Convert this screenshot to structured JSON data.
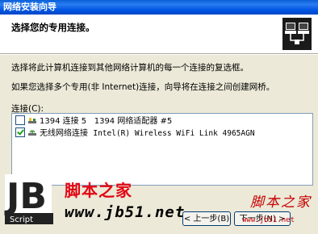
{
  "window": {
    "title": "网络安装向导"
  },
  "header": {
    "title": "选择您的专用连接。"
  },
  "body": {
    "instruction1": "选择将此计算机连接到其他网络计算机的每一个连接的复选框。",
    "instruction2": "如果您选择多个专用(非 Internet)连接，向导将在连接之间创建网桥。",
    "connections_label": "连接(C):"
  },
  "connections": [
    {
      "name": "1394 连接 5",
      "device": "1394 网络适配器 #5",
      "checked": false
    },
    {
      "name": "无线网络连接",
      "device": "Intel(R) Wireless WiFi Link 4965AGN",
      "checked": true
    }
  ],
  "buttons": {
    "back": "< 上一步(B)",
    "next": "下一步(N) >"
  },
  "watermarks": {
    "logo_letters": "JB",
    "logo_script": "Script",
    "brand": "脚本之家",
    "url": "www.jb51.net",
    "brand2": "脚本之家",
    "url2": "www.jb51.net"
  },
  "colors": {
    "titlebar": "#0054e3",
    "dialog_bg": "#ece9d8",
    "watermark_red": "#e30613"
  }
}
